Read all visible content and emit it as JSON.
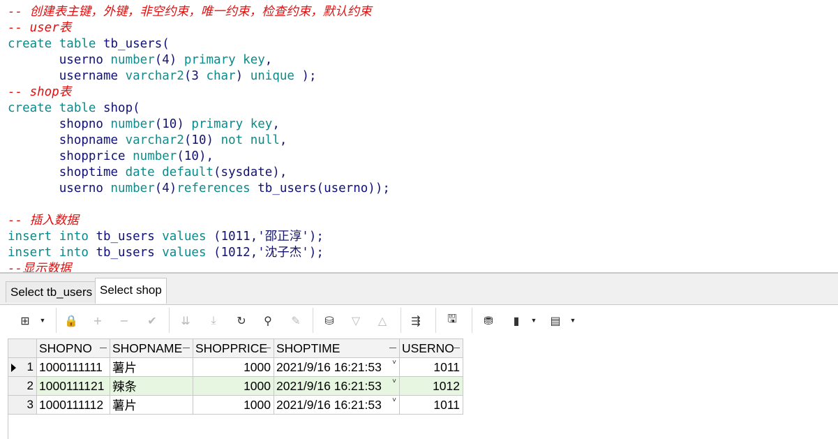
{
  "editor": {
    "lines": [
      [
        {
          "t": "-- 创建表主键，外键，非空约束，唯一约束，检查约束，默认约束",
          "c": "cm"
        }
      ],
      [
        {
          "t": "-- user表",
          "c": "cm"
        }
      ],
      [
        {
          "t": "create table ",
          "c": "kw"
        },
        {
          "t": "tb_users(",
          "c": "id"
        }
      ],
      [
        {
          "t": "       userno ",
          "c": "id"
        },
        {
          "t": "number",
          "c": "ty"
        },
        {
          "t": "(4) ",
          "c": "pu"
        },
        {
          "t": "primary key",
          "c": "kw"
        },
        {
          "t": ",",
          "c": "pu"
        }
      ],
      [
        {
          "t": "       username ",
          "c": "id"
        },
        {
          "t": "varchar2",
          "c": "ty"
        },
        {
          "t": "(3 ",
          "c": "pu"
        },
        {
          "t": "char",
          "c": "kw"
        },
        {
          "t": ") ",
          "c": "pu"
        },
        {
          "t": "unique",
          "c": "kw"
        },
        {
          "t": " );",
          "c": "pu"
        }
      ],
      [
        {
          "t": "-- shop表",
          "c": "cm"
        }
      ],
      [
        {
          "t": "create table ",
          "c": "kw"
        },
        {
          "t": "shop(",
          "c": "id"
        }
      ],
      [
        {
          "t": "       shopno ",
          "c": "id"
        },
        {
          "t": "number",
          "c": "ty"
        },
        {
          "t": "(10) ",
          "c": "pu"
        },
        {
          "t": "primary key",
          "c": "kw"
        },
        {
          "t": ",",
          "c": "pu"
        }
      ],
      [
        {
          "t": "       shopname ",
          "c": "id"
        },
        {
          "t": "varchar2",
          "c": "ty"
        },
        {
          "t": "(10) ",
          "c": "pu"
        },
        {
          "t": "not null",
          "c": "kw"
        },
        {
          "t": ",",
          "c": "pu"
        }
      ],
      [
        {
          "t": "       shopprice ",
          "c": "id"
        },
        {
          "t": "number",
          "c": "ty"
        },
        {
          "t": "(10),",
          "c": "pu"
        }
      ],
      [
        {
          "t": "       shoptime ",
          "c": "id"
        },
        {
          "t": "date default",
          "c": "kw"
        },
        {
          "t": "(sysdate),",
          "c": "pu"
        }
      ],
      [
        {
          "t": "       userno ",
          "c": "id"
        },
        {
          "t": "number",
          "c": "ty"
        },
        {
          "t": "(4)",
          "c": "pu"
        },
        {
          "t": "references ",
          "c": "kw"
        },
        {
          "t": "tb_users(userno));",
          "c": "id"
        }
      ],
      [
        {
          "t": "",
          "c": "pu"
        }
      ],
      [
        {
          "t": "-- 插入数据",
          "c": "cm"
        }
      ],
      [
        {
          "t": "insert into ",
          "c": "kw"
        },
        {
          "t": "tb_users ",
          "c": "id"
        },
        {
          "t": "values ",
          "c": "kw"
        },
        {
          "t": "(1011,'邵正淳');",
          "c": "pu"
        }
      ],
      [
        {
          "t": "insert into ",
          "c": "kw"
        },
        {
          "t": "tb_users ",
          "c": "id"
        },
        {
          "t": "values ",
          "c": "kw"
        },
        {
          "t": "(1012,'沈子杰');",
          "c": "pu"
        }
      ],
      [
        {
          "t": "--显示数据",
          "c": "cm"
        }
      ]
    ]
  },
  "tabs": [
    {
      "label": "Select tb_users",
      "active": false
    },
    {
      "label": "Select shop",
      "active": true
    }
  ],
  "toolbar": {
    "items": [
      {
        "name": "grid-view-icon",
        "glyph": "⊞",
        "enabled": true,
        "dropdown": true
      },
      {
        "name": "lock-icon",
        "glyph": "🔒",
        "enabled": true
      },
      {
        "name": "add-record-icon",
        "glyph": "+",
        "enabled": false
      },
      {
        "name": "delete-record-icon",
        "glyph": "−",
        "enabled": false
      },
      {
        "name": "post-changes-icon",
        "glyph": "✔",
        "enabled": false
      },
      {
        "name": "fetch-next-page-icon",
        "glyph": "⇊",
        "enabled": false
      },
      {
        "name": "fetch-last-page-icon",
        "glyph": "⤓",
        "enabled": false
      },
      {
        "name": "refresh-icon",
        "glyph": "↻",
        "enabled": true
      },
      {
        "name": "find-binoculars-icon",
        "glyph": "⚲",
        "enabled": true
      },
      {
        "name": "clear-filter-icon",
        "glyph": "✎",
        "enabled": false
      },
      {
        "name": "query-by-example-icon",
        "glyph": "⛁",
        "enabled": true
      },
      {
        "name": "previous-record-icon",
        "glyph": "▽",
        "enabled": false
      },
      {
        "name": "next-record-icon",
        "glyph": "△",
        "enabled": false
      },
      {
        "name": "single-record-view-icon",
        "glyph": "⇶",
        "enabled": true
      },
      {
        "name": "save-icon",
        "glyph": "🖫",
        "enabled": true
      },
      {
        "name": "export-icon",
        "glyph": "⛃",
        "enabled": true
      },
      {
        "name": "chart-icon",
        "glyph": "▮",
        "enabled": true,
        "dropdown": true
      },
      {
        "name": "table-icon",
        "glyph": "▤",
        "enabled": true,
        "dropdown": true
      }
    ]
  },
  "grid": {
    "columns": [
      "SHOPNO",
      "SHOPNAME",
      "SHOPPRICE",
      "SHOPTIME",
      "USERNO"
    ],
    "rows": [
      {
        "num": "1",
        "shopno": "1000111111",
        "shopname": "薯片",
        "shopprice": "1000",
        "shoptime": "2021/9/16 16:21:53",
        "userno": "1011",
        "current": true
      },
      {
        "num": "2",
        "shopno": "1000111121",
        "shopname": "辣条",
        "shopprice": "1000",
        "shoptime": "2021/9/16 16:21:53",
        "userno": "1012",
        "current": false
      },
      {
        "num": "3",
        "shopno": "1000111112",
        "shopname": "薯片",
        "shopprice": "1000",
        "shoptime": "2021/9/16 16:21:53",
        "userno": "1011",
        "current": false
      }
    ],
    "colors": {
      "alt_row": "#e6f6e0",
      "header_bg": "#f3f3f3",
      "grid_line": "#c8c8c8"
    }
  },
  "theme": {
    "comment": "#e01010",
    "keyword": "#0a8a8a",
    "identifier": "#10107a"
  }
}
